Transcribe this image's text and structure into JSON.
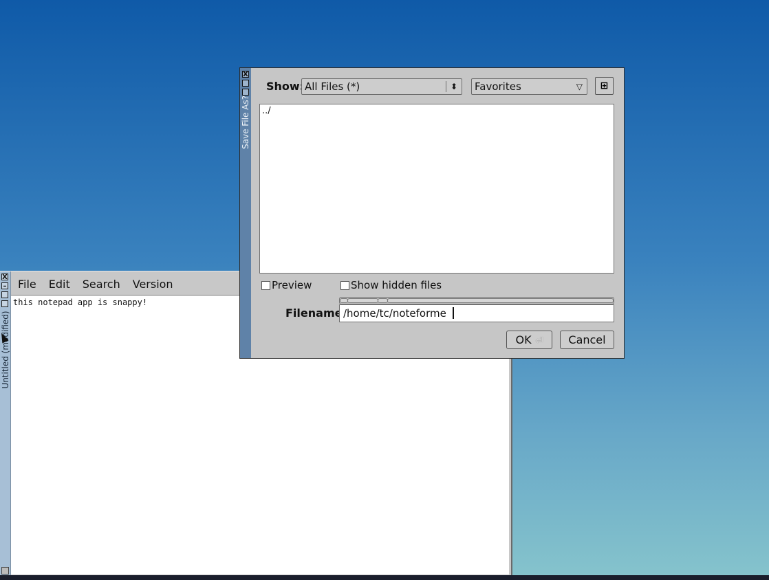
{
  "notepad": {
    "title": "Untitled (modified)",
    "menu": [
      "File",
      "Edit",
      "Search",
      "Version"
    ],
    "content": "this notepad app is snappy!",
    "window_buttons": {
      "close": "X",
      "minimize": "–"
    }
  },
  "dialog": {
    "title": "Save File As?",
    "show_label": "Show:",
    "show_value": "All Files (*)",
    "favorites_label": "Favorites",
    "new_folder_icon": "new-folder-icon",
    "files": [
      "../"
    ],
    "preview_label": "Preview",
    "hidden_label": "Show hidden files",
    "preview_checked": false,
    "hidden_checked": false,
    "filename_label": "Filename:",
    "filename_value": "/home/tc/noteforme",
    "ok_label": "OK",
    "cancel_label": "Cancel",
    "window_buttons": {
      "close": "X"
    }
  },
  "colors": {
    "dialog_titlebar": "#5f82a8",
    "notepad_titlebar": "#a7bfd6",
    "window_bg": "#c6c6c6"
  }
}
